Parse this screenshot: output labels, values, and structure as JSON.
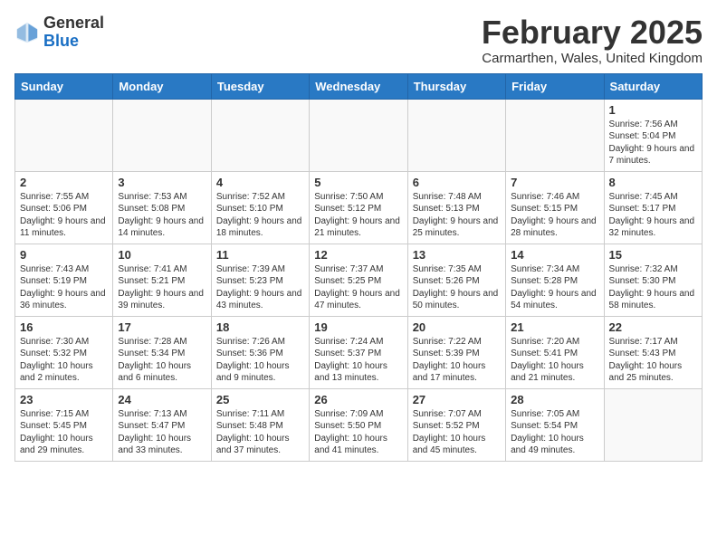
{
  "header": {
    "logo_general": "General",
    "logo_blue": "Blue",
    "month_title": "February 2025",
    "subtitle": "Carmarthen, Wales, United Kingdom"
  },
  "days_of_week": [
    "Sunday",
    "Monday",
    "Tuesday",
    "Wednesday",
    "Thursday",
    "Friday",
    "Saturday"
  ],
  "weeks": [
    [
      {
        "day": "",
        "info": ""
      },
      {
        "day": "",
        "info": ""
      },
      {
        "day": "",
        "info": ""
      },
      {
        "day": "",
        "info": ""
      },
      {
        "day": "",
        "info": ""
      },
      {
        "day": "",
        "info": ""
      },
      {
        "day": "1",
        "info": "Sunrise: 7:56 AM\nSunset: 5:04 PM\nDaylight: 9 hours and 7 minutes."
      }
    ],
    [
      {
        "day": "2",
        "info": "Sunrise: 7:55 AM\nSunset: 5:06 PM\nDaylight: 9 hours and 11 minutes."
      },
      {
        "day": "3",
        "info": "Sunrise: 7:53 AM\nSunset: 5:08 PM\nDaylight: 9 hours and 14 minutes."
      },
      {
        "day": "4",
        "info": "Sunrise: 7:52 AM\nSunset: 5:10 PM\nDaylight: 9 hours and 18 minutes."
      },
      {
        "day": "5",
        "info": "Sunrise: 7:50 AM\nSunset: 5:12 PM\nDaylight: 9 hours and 21 minutes."
      },
      {
        "day": "6",
        "info": "Sunrise: 7:48 AM\nSunset: 5:13 PM\nDaylight: 9 hours and 25 minutes."
      },
      {
        "day": "7",
        "info": "Sunrise: 7:46 AM\nSunset: 5:15 PM\nDaylight: 9 hours and 28 minutes."
      },
      {
        "day": "8",
        "info": "Sunrise: 7:45 AM\nSunset: 5:17 PM\nDaylight: 9 hours and 32 minutes."
      }
    ],
    [
      {
        "day": "9",
        "info": "Sunrise: 7:43 AM\nSunset: 5:19 PM\nDaylight: 9 hours and 36 minutes."
      },
      {
        "day": "10",
        "info": "Sunrise: 7:41 AM\nSunset: 5:21 PM\nDaylight: 9 hours and 39 minutes."
      },
      {
        "day": "11",
        "info": "Sunrise: 7:39 AM\nSunset: 5:23 PM\nDaylight: 9 hours and 43 minutes."
      },
      {
        "day": "12",
        "info": "Sunrise: 7:37 AM\nSunset: 5:25 PM\nDaylight: 9 hours and 47 minutes."
      },
      {
        "day": "13",
        "info": "Sunrise: 7:35 AM\nSunset: 5:26 PM\nDaylight: 9 hours and 50 minutes."
      },
      {
        "day": "14",
        "info": "Sunrise: 7:34 AM\nSunset: 5:28 PM\nDaylight: 9 hours and 54 minutes."
      },
      {
        "day": "15",
        "info": "Sunrise: 7:32 AM\nSunset: 5:30 PM\nDaylight: 9 hours and 58 minutes."
      }
    ],
    [
      {
        "day": "16",
        "info": "Sunrise: 7:30 AM\nSunset: 5:32 PM\nDaylight: 10 hours and 2 minutes."
      },
      {
        "day": "17",
        "info": "Sunrise: 7:28 AM\nSunset: 5:34 PM\nDaylight: 10 hours and 6 minutes."
      },
      {
        "day": "18",
        "info": "Sunrise: 7:26 AM\nSunset: 5:36 PM\nDaylight: 10 hours and 9 minutes."
      },
      {
        "day": "19",
        "info": "Sunrise: 7:24 AM\nSunset: 5:37 PM\nDaylight: 10 hours and 13 minutes."
      },
      {
        "day": "20",
        "info": "Sunrise: 7:22 AM\nSunset: 5:39 PM\nDaylight: 10 hours and 17 minutes."
      },
      {
        "day": "21",
        "info": "Sunrise: 7:20 AM\nSunset: 5:41 PM\nDaylight: 10 hours and 21 minutes."
      },
      {
        "day": "22",
        "info": "Sunrise: 7:17 AM\nSunset: 5:43 PM\nDaylight: 10 hours and 25 minutes."
      }
    ],
    [
      {
        "day": "23",
        "info": "Sunrise: 7:15 AM\nSunset: 5:45 PM\nDaylight: 10 hours and 29 minutes."
      },
      {
        "day": "24",
        "info": "Sunrise: 7:13 AM\nSunset: 5:47 PM\nDaylight: 10 hours and 33 minutes."
      },
      {
        "day": "25",
        "info": "Sunrise: 7:11 AM\nSunset: 5:48 PM\nDaylight: 10 hours and 37 minutes."
      },
      {
        "day": "26",
        "info": "Sunrise: 7:09 AM\nSunset: 5:50 PM\nDaylight: 10 hours and 41 minutes."
      },
      {
        "day": "27",
        "info": "Sunrise: 7:07 AM\nSunset: 5:52 PM\nDaylight: 10 hours and 45 minutes."
      },
      {
        "day": "28",
        "info": "Sunrise: 7:05 AM\nSunset: 5:54 PM\nDaylight: 10 hours and 49 minutes."
      },
      {
        "day": "",
        "info": ""
      }
    ]
  ]
}
